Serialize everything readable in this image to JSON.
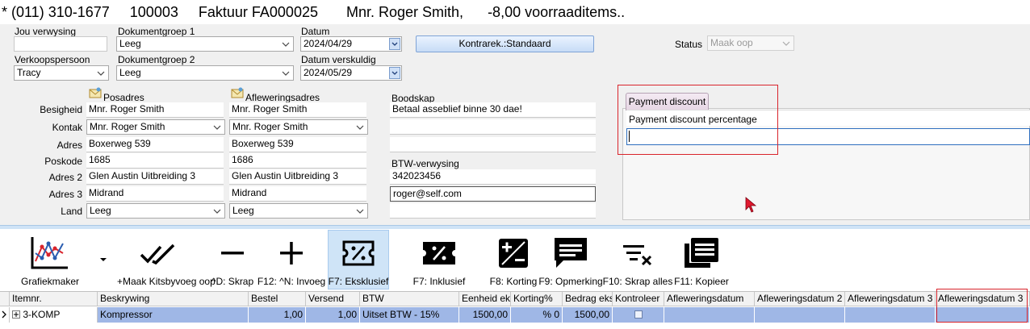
{
  "title_bar": {
    "phone": "* (011) 310-1677",
    "account": "100003",
    "document": "Faktuur FA000025",
    "customer": "Mnr. Roger Smith,",
    "stock_note": "-8,00 voorraaditems.."
  },
  "header": {
    "jou_verwysing_label": "Jou verwysing",
    "jou_verwysing_value": "",
    "dokumentgroep1_label": "Dokumentgroep 1",
    "dokumentgroep1_value": "Leeg",
    "datum_label": "Datum",
    "datum_value": "2024/04/29",
    "kontrarek_button": "Kontrarek.:Standaard",
    "status_label": "Status",
    "status_value": "Maak oop",
    "verkoopspersoon_label": "Verkoopspersoon",
    "verkoopspersoon_value": "Tracy",
    "dokumentgroep2_label": "Dokumentgroep 2",
    "dokumentgroep2_value": "Leeg",
    "datum_verskuldig_label": "Datum verskuldig",
    "datum_verskuldig_value": "2024/05/29"
  },
  "address": {
    "posadres_header": "Posadres",
    "aflewering_header": "Afleweringsadres",
    "labels": {
      "besigheid": "Besigheid",
      "kontak": "Kontak",
      "adres": "Adres",
      "poskode": "Poskode",
      "adres2": "Adres 2",
      "adres3": "Adres 3",
      "land": "Land"
    },
    "posadres": {
      "besigheid": "Mnr. Roger Smith",
      "kontak": "Mnr. Roger Smith",
      "adres": "Boxerweg 539",
      "poskode": "1685",
      "adres2": "Glen Austin Uitbreiding 3",
      "adres3": "Midrand",
      "land": "Leeg"
    },
    "aflewering": {
      "besigheid": "Mnr. Roger Smith",
      "kontak": "Mnr. Roger Smith",
      "adres": "Boxerweg 539",
      "poskode": "1686",
      "adres2": "Glen Austin Uitbreiding 3",
      "adres3": "Midrand",
      "land": "Leeg"
    }
  },
  "message": {
    "boodskap_label": "Boodskap",
    "boodskap_value": "Betaal asseblief binne 30 dae!",
    "btw_label": "BTW-verwysing",
    "btw_value": "342023456",
    "email_value": "roger@self.com"
  },
  "payment_panel": {
    "tab_label": "Payment discount",
    "field_label": "Payment discount percentage",
    "field_value": ""
  },
  "toolbar": {
    "grafiekmaker": "Grafiekmaker",
    "maak_kits": "+Maak Kitsbyvoeg oop",
    "skrap": "^D: Skrap",
    "invoeg": "F12: ^N: Invoeg",
    "eksklusief": "F7: Eksklusief",
    "inklusief": "F7: Inklusief",
    "korting": "F8: Korting",
    "opmerking": "F9: Opmerking",
    "skrap_alles": "F10: Skrap alles",
    "kopieer": "F11: Kopieer"
  },
  "grid": {
    "columns": [
      "Itemnr.",
      "Beskrywing",
      "Bestel",
      "Versend",
      "BTW",
      "Eenheid eks",
      "Korting%",
      "Bedrag eks",
      "Kontroleer",
      "Afleweringsdatum",
      "Afleweringsdatum 2",
      "Afleweringsdatum 3",
      "Afleweringsdatum 3"
    ],
    "row": {
      "itemnr": "3-KOMP",
      "beskrywing": "Kompressor",
      "bestel": "1,00",
      "versend": "1,00",
      "btw": "Uitset BTW - 15%",
      "eenheid": "1500,00",
      "korting": "% 0",
      "bedrag": "1500,00"
    }
  },
  "colors": {
    "selection_row": "#9fb7e6",
    "highlight_box": "#d9242c",
    "accent_button": "#c7dcf6"
  }
}
